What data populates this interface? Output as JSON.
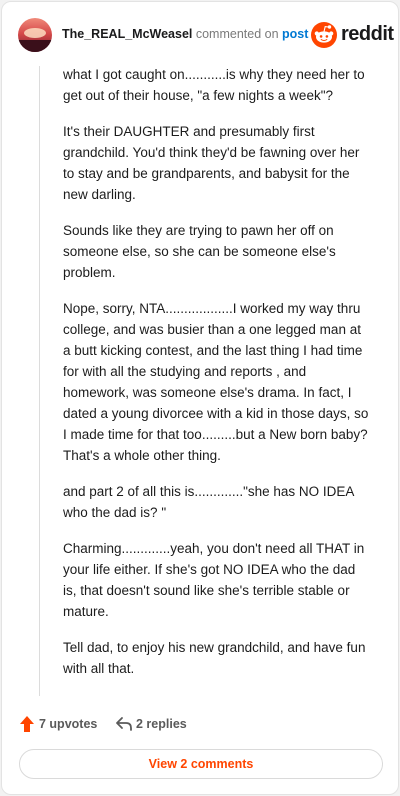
{
  "header": {
    "username": "The_REAL_McWeasel",
    "commented_on_text": "commented on",
    "post_link": "post",
    "logo_word": "reddit"
  },
  "comment": {
    "paragraphs": [
      "what I got caught on...........is why they need her to get out of their house, \"a few nights a week\"?",
      "It's their DAUGHTER and presumably first grandchild. You'd think they'd be fawning over her to stay and be grandparents, and babysit for the new darling.",
      "Sounds like they are trying to pawn her off on someone else, so she can be someone else's problem.",
      "Nope, sorry, NTA..................I worked my way thru college, and was busier than a one legged man at a butt kicking contest, and the last thing I had time for with all the studying and reports , and homework, was someone else's drama. In fact, I dated a young divorcee with a kid in those days, so I made time for that too.........but a New born baby? That's a whole other thing.",
      "and part 2 of all this is.............\"she has NO IDEA who the dad is? \"",
      "Charming.............yeah, you don't need all THAT in your life either. If she's got NO IDEA who the dad is, that doesn't sound like she's terrible stable or mature.",
      "Tell dad, to enjoy his new grandchild, and have fun with all that."
    ]
  },
  "actions": {
    "upvotes_label": "7 upvotes",
    "replies_label": "2 replies",
    "view_comments_label": "View 2 comments"
  },
  "colors": {
    "accent_orange": "#ff4500",
    "link_blue": "#0079d3"
  },
  "icons": [
    "avatar",
    "reddit-logo-icon",
    "upvote-arrow-icon",
    "reply-arrow-icon"
  ]
}
